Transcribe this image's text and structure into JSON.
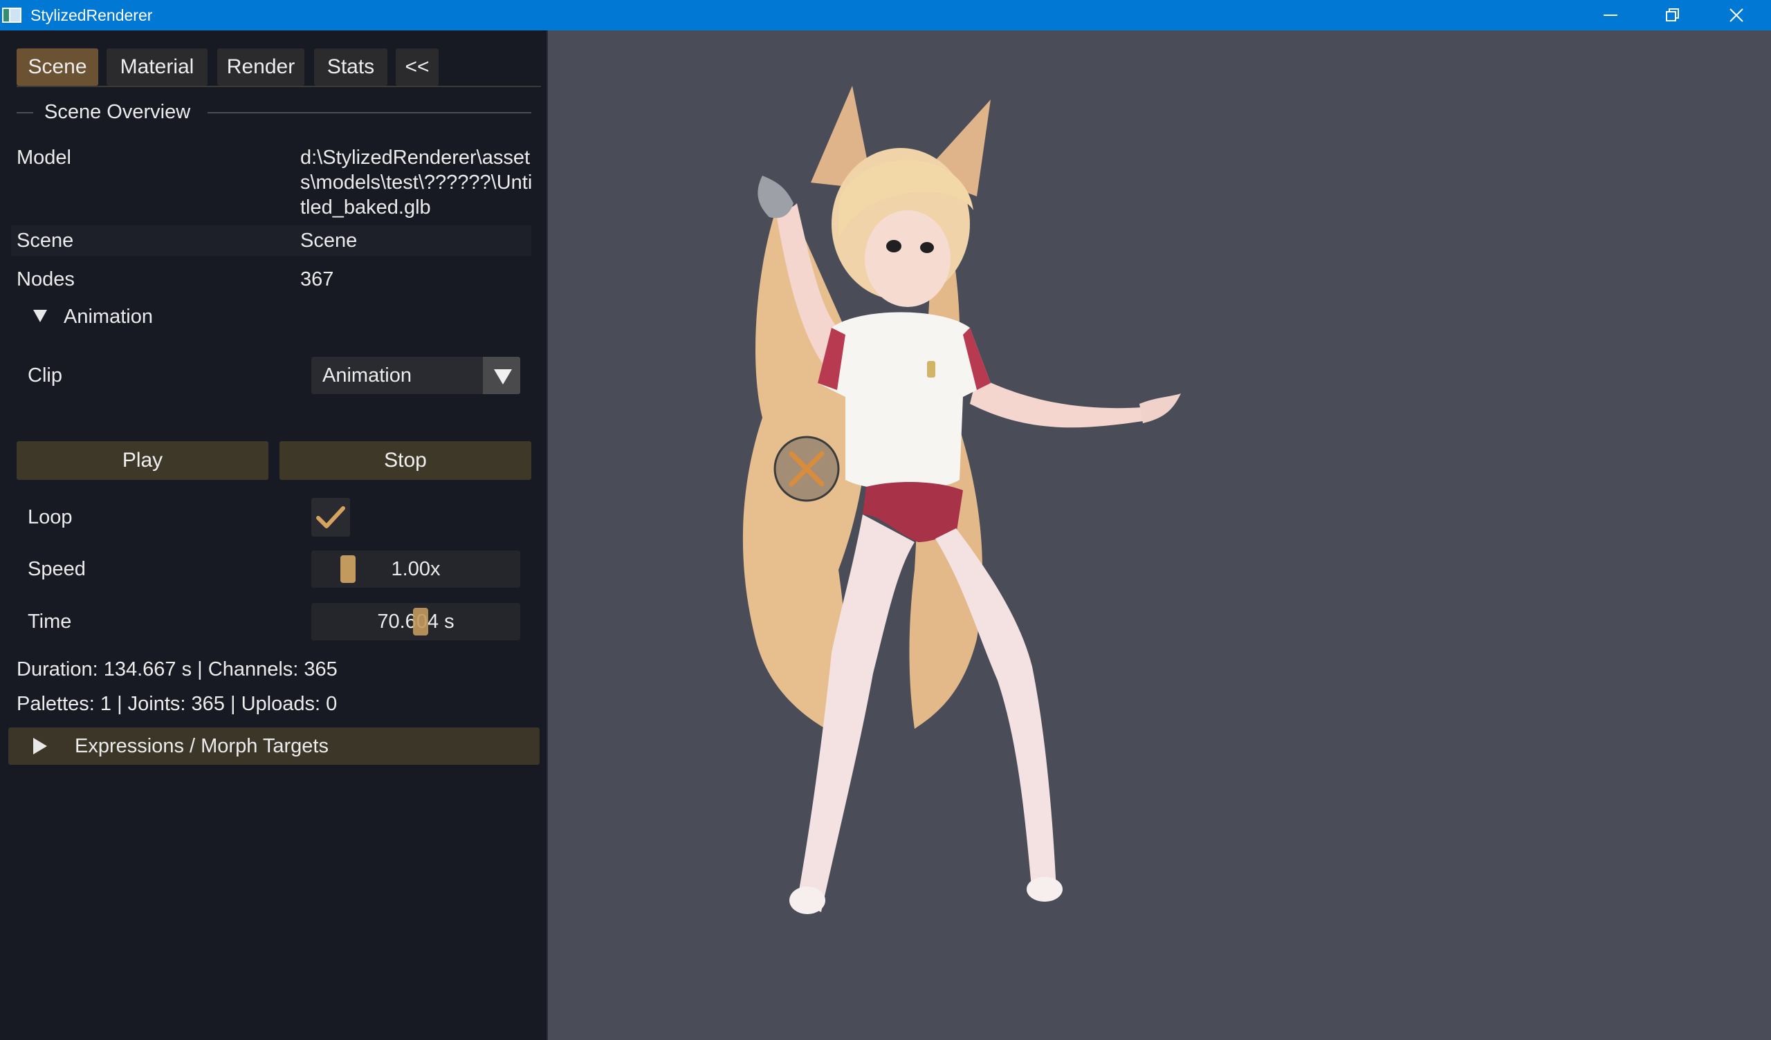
{
  "window": {
    "title": "StylizedRenderer"
  },
  "tabs": [
    {
      "label": "Scene",
      "active": true
    },
    {
      "label": "Material",
      "active": false
    },
    {
      "label": "Render",
      "active": false
    },
    {
      "label": "Stats",
      "active": false
    },
    {
      "label": "<<",
      "active": false
    }
  ],
  "overview": {
    "section_title": "Scene Overview",
    "model_label": "Model",
    "model_value": "d:\\StylizedRenderer\\assets\\models\\test\\??????\\Untitled_baked.glb",
    "scene_label": "Scene",
    "scene_value": "Scene",
    "nodes_label": "Nodes",
    "nodes_value": "367"
  },
  "animation": {
    "header": "Animation",
    "expanded": true,
    "clip_label": "Clip",
    "clip_value": "Animation",
    "play_label": "Play",
    "stop_label": "Stop",
    "loop_label": "Loop",
    "loop_checked": true,
    "speed_label": "Speed",
    "speed_value": "1.00x",
    "speed_fraction": 0.15,
    "time_label": "Time",
    "time_value": "70.604 s",
    "time_fraction": 0.524,
    "info_line1": "Duration: 134.667 s | Channels: 365",
    "info_line2": "Palettes: 1 | Joints: 365 | Uploads: 0"
  },
  "expressions": {
    "header": "Expressions / Morph Targets",
    "expanded": false
  },
  "colors": {
    "titlebar": "#0078d4",
    "panel_bg": "#171923",
    "viewport_bg": "#4a4c57",
    "accent": "#c39a5e",
    "active_tab": "#6a5233",
    "button": "#3e3829"
  },
  "icons": {
    "app": "app-window-icon",
    "minimize": "minimize-icon",
    "maximize": "restore-icon",
    "close": "close-icon",
    "gizmo": "light-gizmo-icon"
  }
}
